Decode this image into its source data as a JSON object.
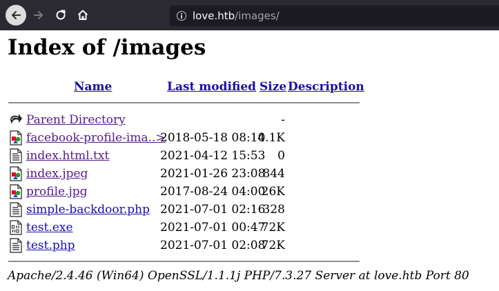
{
  "browser": {
    "url_host": "love.htb",
    "url_path": "/images/"
  },
  "page": {
    "title": "Index of /images",
    "columns": {
      "name": "Name",
      "last_modified": "Last modified",
      "size": "Size",
      "description": "Description"
    },
    "parent": {
      "name": "Parent Directory",
      "size": "-"
    },
    "files": [
      {
        "name": "facebook-profile-ima..>",
        "modified": "2018-05-18 08:10",
        "size": "4.1K",
        "icon": "image-icon"
      },
      {
        "name": "index.html.txt",
        "modified": "2021-04-12 15:53",
        "size": "0",
        "icon": "text-file-icon"
      },
      {
        "name": "index.jpeg",
        "modified": "2021-01-26 23:08",
        "size": "844",
        "icon": "image-icon"
      },
      {
        "name": "profile.jpg",
        "modified": "2017-08-24 04:00",
        "size": "26K",
        "icon": "image-icon"
      },
      {
        "name": "simple-backdoor.php",
        "modified": "2021-07-01 02:16",
        "size": "328",
        "icon": "text-file-icon"
      },
      {
        "name": "test.exe",
        "modified": "2021-07-01 00:47",
        "size": "72K",
        "icon": "binary-file-icon"
      },
      {
        "name": "test.php",
        "modified": "2021-07-01 02:08",
        "size": "72K",
        "icon": "text-file-icon"
      }
    ],
    "address": "Apache/2.4.46 (Win64) OpenSSL/1.1.1j PHP/7.3.27 Server at love.htb Port 80"
  },
  "colors": {
    "toolbar_bg": "#2b2a33",
    "link": "#1a0dab",
    "visited_link": "#551a8b"
  }
}
